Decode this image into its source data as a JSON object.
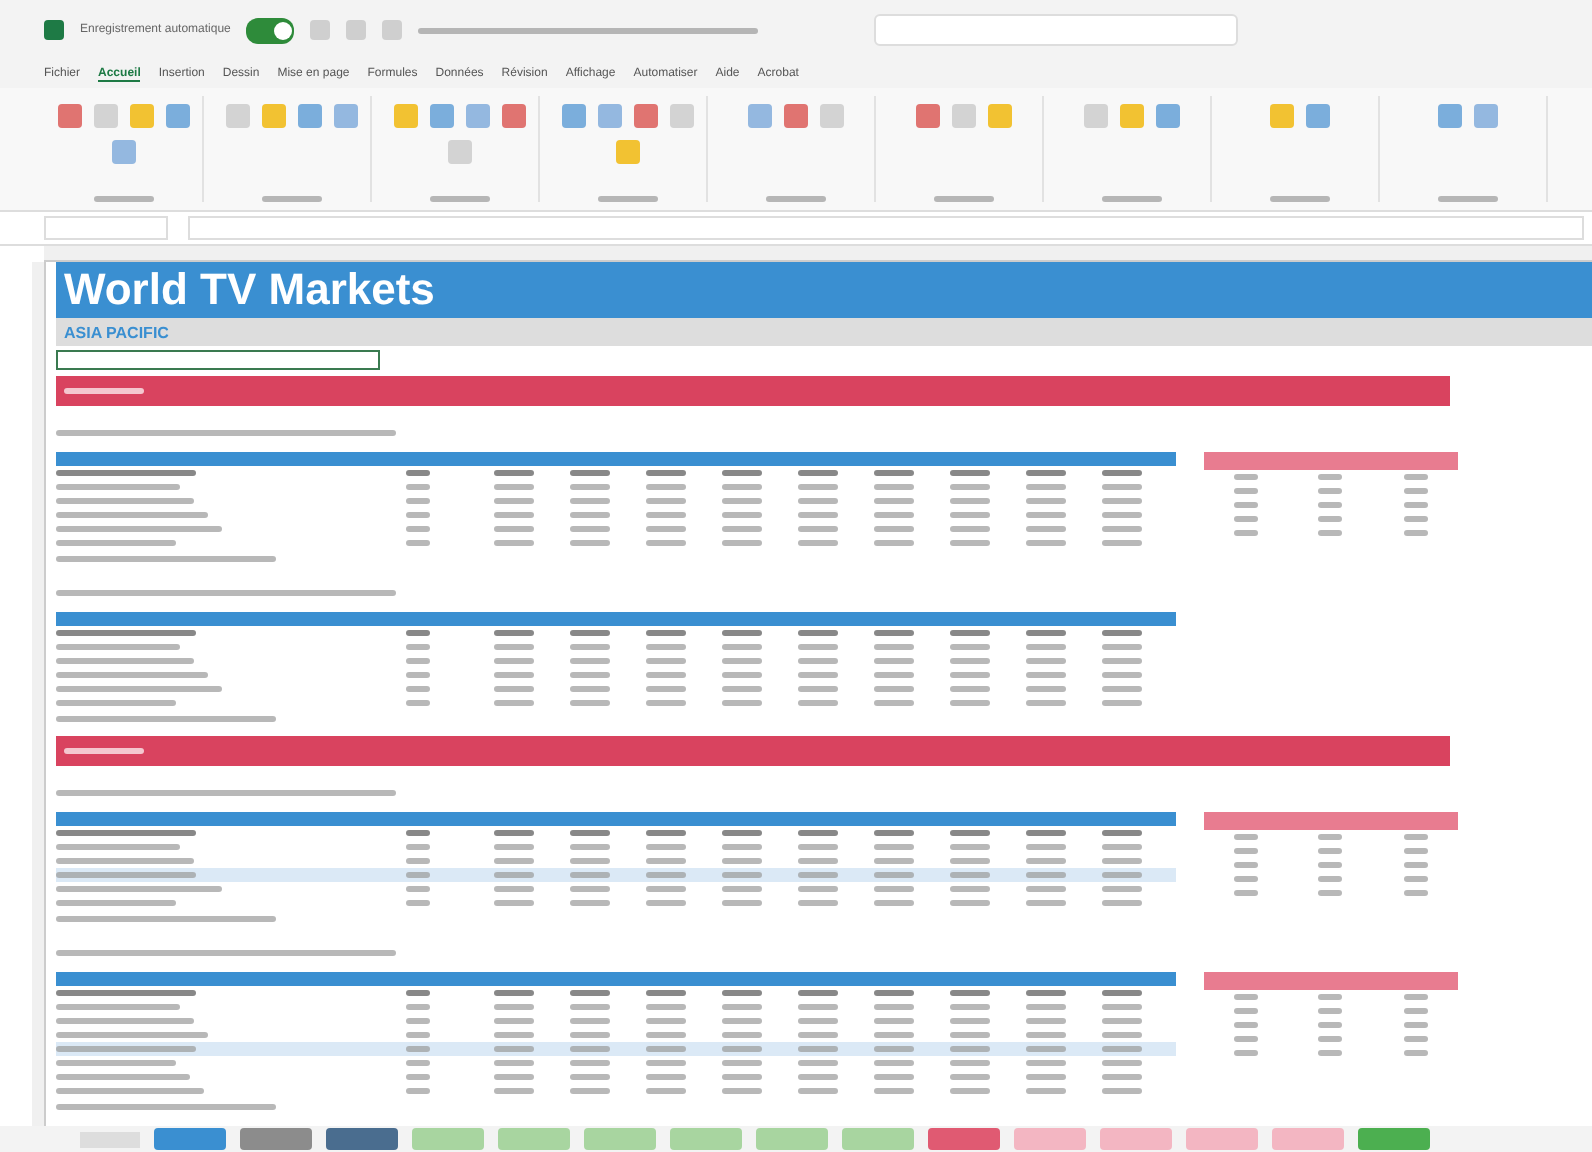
{
  "title_bar": {
    "autosave_label": "Enregistrement automatique",
    "autosave_on": true
  },
  "ribbon_tabs": [
    {
      "label": "Fichier",
      "selected": false
    },
    {
      "label": "Accueil",
      "selected": true
    },
    {
      "label": "Insertion",
      "selected": false
    },
    {
      "label": "Dessin",
      "selected": false
    },
    {
      "label": "Mise en page",
      "selected": false
    },
    {
      "label": "Formules",
      "selected": false
    },
    {
      "label": "Données",
      "selected": false
    },
    {
      "label": "Révision",
      "selected": false
    },
    {
      "label": "Affichage",
      "selected": false
    },
    {
      "label": "Automatiser",
      "selected": false
    },
    {
      "label": "Aide",
      "selected": false
    },
    {
      "label": "Acrobat",
      "selected": false
    }
  ],
  "sheet": {
    "title": "World TV Markets",
    "subtitle": "ASIA PACIFIC",
    "sections": [
      {
        "tables": [
          {
            "rows": [
              {
                "kind": "bold"
              },
              {
                "kind": "normal"
              },
              {
                "kind": "normal"
              },
              {
                "kind": "normal"
              },
              {
                "kind": "normal"
              },
              {
                "kind": "normal"
              }
            ],
            "side_table": true
          },
          {
            "rows": [
              {
                "kind": "bold"
              },
              {
                "kind": "normal"
              },
              {
                "kind": "normal"
              },
              {
                "kind": "normal"
              },
              {
                "kind": "normal"
              },
              {
                "kind": "normal"
              }
            ],
            "side_table": false
          }
        ]
      },
      {
        "tables": [
          {
            "rows": [
              {
                "kind": "bold"
              },
              {
                "kind": "normal"
              },
              {
                "kind": "normal"
              },
              {
                "kind": "shaded"
              },
              {
                "kind": "normal"
              },
              {
                "kind": "normal"
              }
            ],
            "side_table": true
          },
          {
            "rows": [
              {
                "kind": "bold"
              },
              {
                "kind": "normal"
              },
              {
                "kind": "normal"
              },
              {
                "kind": "normal"
              },
              {
                "kind": "shaded"
              },
              {
                "kind": "normal"
              },
              {
                "kind": "normal"
              },
              {
                "kind": "normal"
              }
            ],
            "side_table": true
          }
        ]
      }
    ]
  },
  "sheet_tabs": [
    {
      "color": "#3a8fd1"
    },
    {
      "color": "#8c8c8c"
    },
    {
      "color": "#4a6d8f"
    },
    {
      "color": "#a8d5a0"
    },
    {
      "color": "#a8d5a0"
    },
    {
      "color": "#a8d5a0"
    },
    {
      "color": "#a8d5a0"
    },
    {
      "color": "#a8d5a0"
    },
    {
      "color": "#a8d5a0"
    },
    {
      "color": "#e05a72"
    },
    {
      "color": "#f3b6c2"
    },
    {
      "color": "#f3b6c2"
    },
    {
      "color": "#f3b6c2"
    },
    {
      "color": "#f3b6c2"
    },
    {
      "color": "#4caf50"
    }
  ]
}
